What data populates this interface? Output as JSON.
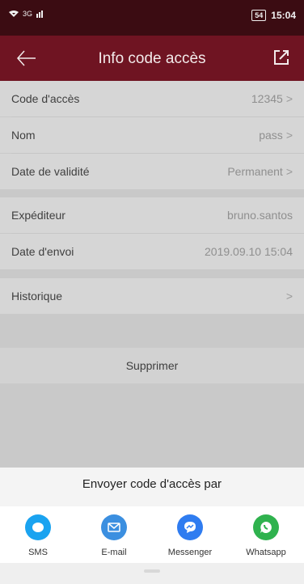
{
  "status": {
    "network": "3G",
    "battery": "54",
    "time": "15:04"
  },
  "header": {
    "title": "Info code accès"
  },
  "rows": {
    "code": {
      "label": "Code d'accès",
      "value": "12345"
    },
    "name": {
      "label": "Nom",
      "value": "pass"
    },
    "validity": {
      "label": "Date de validité",
      "value": "Permanent"
    },
    "sender": {
      "label": "Expéditeur",
      "value": "bruno.santos"
    },
    "send_date": {
      "label": "Date d'envoi",
      "value": "2019.09.10 15:04"
    },
    "history": {
      "label": "Historique"
    }
  },
  "delete_label": "Supprimer",
  "share": {
    "title": "Envoyer code d'accès par",
    "options": [
      {
        "label": "SMS",
        "icon": "sms-icon",
        "color": "#1aa3f0"
      },
      {
        "label": "E-mail",
        "icon": "email-icon",
        "color": "#3b8fe0"
      },
      {
        "label": "Messenger",
        "icon": "messenger-icon",
        "color": "#2f7cf0"
      },
      {
        "label": "Whatsapp",
        "icon": "whatsapp-icon",
        "color": "#2fb24e"
      }
    ]
  },
  "colors": {
    "header_bg": "#6f1422",
    "status_bg": "#3b0c12"
  }
}
